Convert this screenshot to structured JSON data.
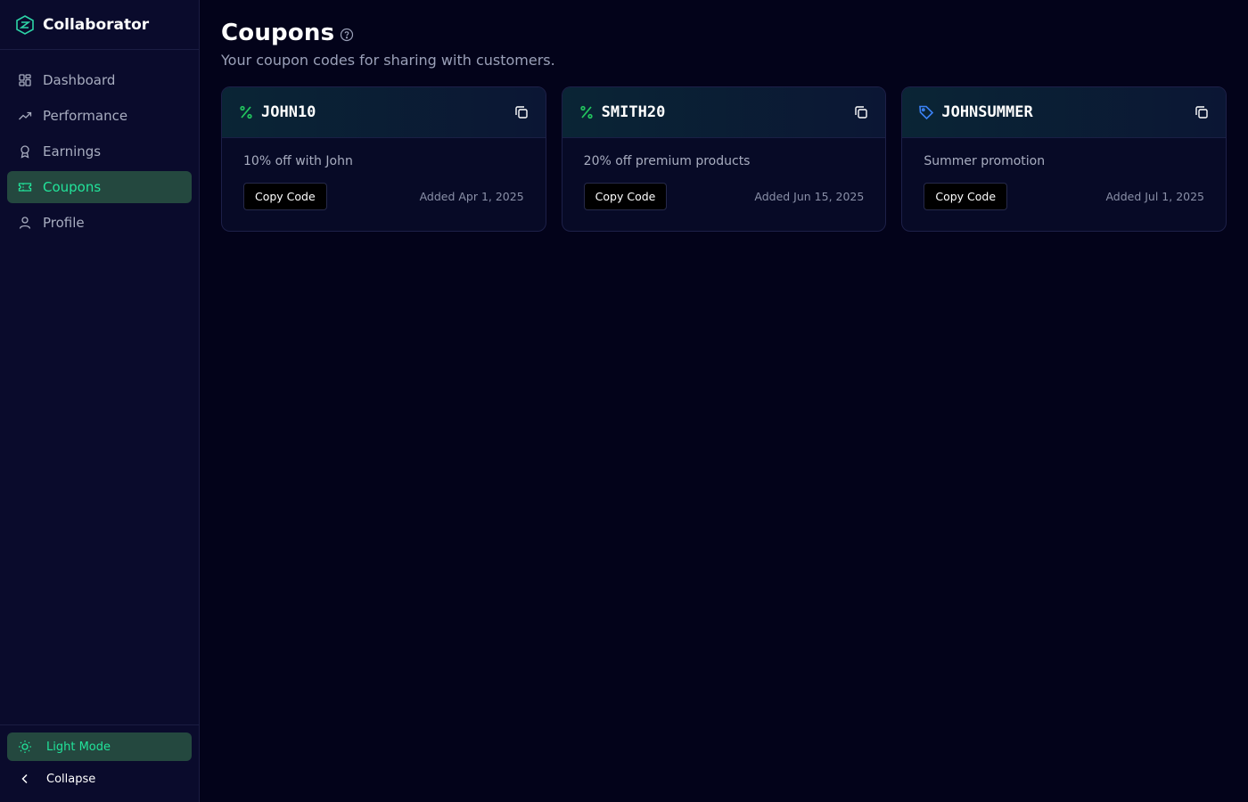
{
  "brand": {
    "name": "Collaborator"
  },
  "nav": [
    {
      "label": "Dashboard",
      "icon": "dashboard-icon"
    },
    {
      "label": "Performance",
      "icon": "trending-up-icon"
    },
    {
      "label": "Earnings",
      "icon": "award-icon"
    },
    {
      "label": "Coupons",
      "icon": "ticket-icon",
      "active": true
    },
    {
      "label": "Profile",
      "icon": "user-icon"
    }
  ],
  "bottom": {
    "theme_label": "Light Mode",
    "collapse_label": "Collapse"
  },
  "page": {
    "title": "Coupons",
    "subtitle": "Your coupon codes for sharing with customers."
  },
  "coupons": [
    {
      "code": "JOHN10",
      "description": "10% off with John",
      "button": "Copy Code",
      "added": "Added Apr 1, 2025",
      "icon": "percent-icon",
      "icon_color": "#22c55e"
    },
    {
      "code": "SMITH20",
      "description": "20% off premium products",
      "button": "Copy Code",
      "added": "Added Jun 15, 2025",
      "icon": "percent-icon",
      "icon_color": "#22c55e"
    },
    {
      "code": "JOHNSUMMER",
      "description": "Summer promotion",
      "button": "Copy Code",
      "added": "Added Jul 1, 2025",
      "icon": "tag-icon",
      "icon_color": "#3b82f6"
    }
  ],
  "colors": {
    "accent": "#22e39a",
    "active_bg": "#24483f",
    "background": "#03031a",
    "sidebar_bg": "#0a0b2c"
  }
}
